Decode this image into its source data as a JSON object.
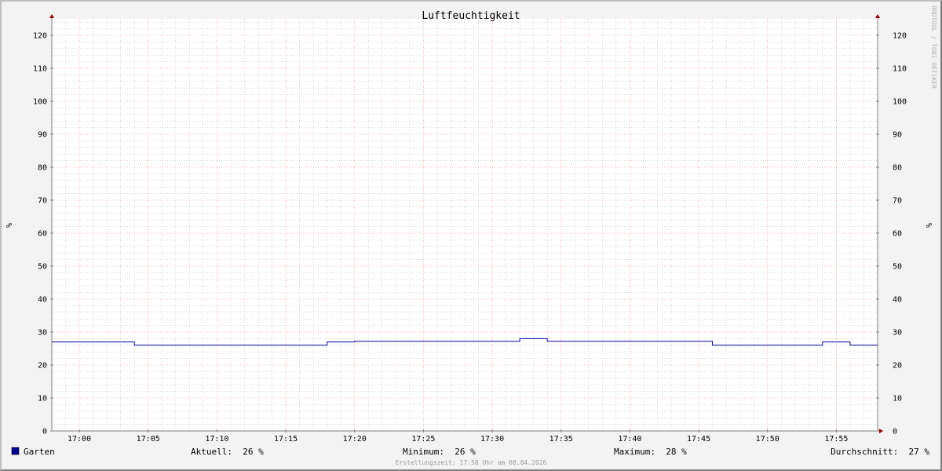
{
  "chart_data": {
    "type": "line",
    "title": "Luftfeuchtigkeit",
    "ylabel": "%",
    "ylim": [
      0,
      125
    ],
    "xlim": [
      "16:58",
      "17:58"
    ],
    "y_ticks": [
      0,
      10,
      20,
      30,
      40,
      50,
      60,
      70,
      80,
      90,
      100,
      110,
      120
    ],
    "x_ticks": [
      "17:00",
      "17:05",
      "17:10",
      "17:15",
      "17:20",
      "17:25",
      "17:30",
      "17:35",
      "17:40",
      "17:45",
      "17:50",
      "17:55"
    ],
    "grid": true,
    "series": [
      {
        "name": "Garten",
        "color": "#000099",
        "step_x": [
          "16:58",
          "17:04",
          "17:18",
          "17:20",
          "17:32",
          "17:34",
          "17:46",
          "17:54",
          "17:56",
          "17:58"
        ],
        "step_y": [
          27,
          26,
          27,
          27.2,
          28,
          27.2,
          26,
          27,
          26,
          26
        ]
      }
    ]
  },
  "legend": {
    "series_label": "Garten",
    "series_color": "#000099",
    "current": "Aktuell:  26 %",
    "minimum": "Minimum:  26 %",
    "maximum": "Maximum:  28 %",
    "average": "Durchschnitt:  27 %"
  },
  "watermark": "RRDTOOL / TOBI OETIKER",
  "footer": "Erstellungszeit: 17:58 Uhr am 08.04.2026",
  "colors": {
    "background": "#f3f3f3",
    "plot_background": "#ffffff",
    "major_grid": "#ff8080",
    "minor_grid": "#b8b8b8",
    "axis": "#808080",
    "arrow": "#990000"
  }
}
